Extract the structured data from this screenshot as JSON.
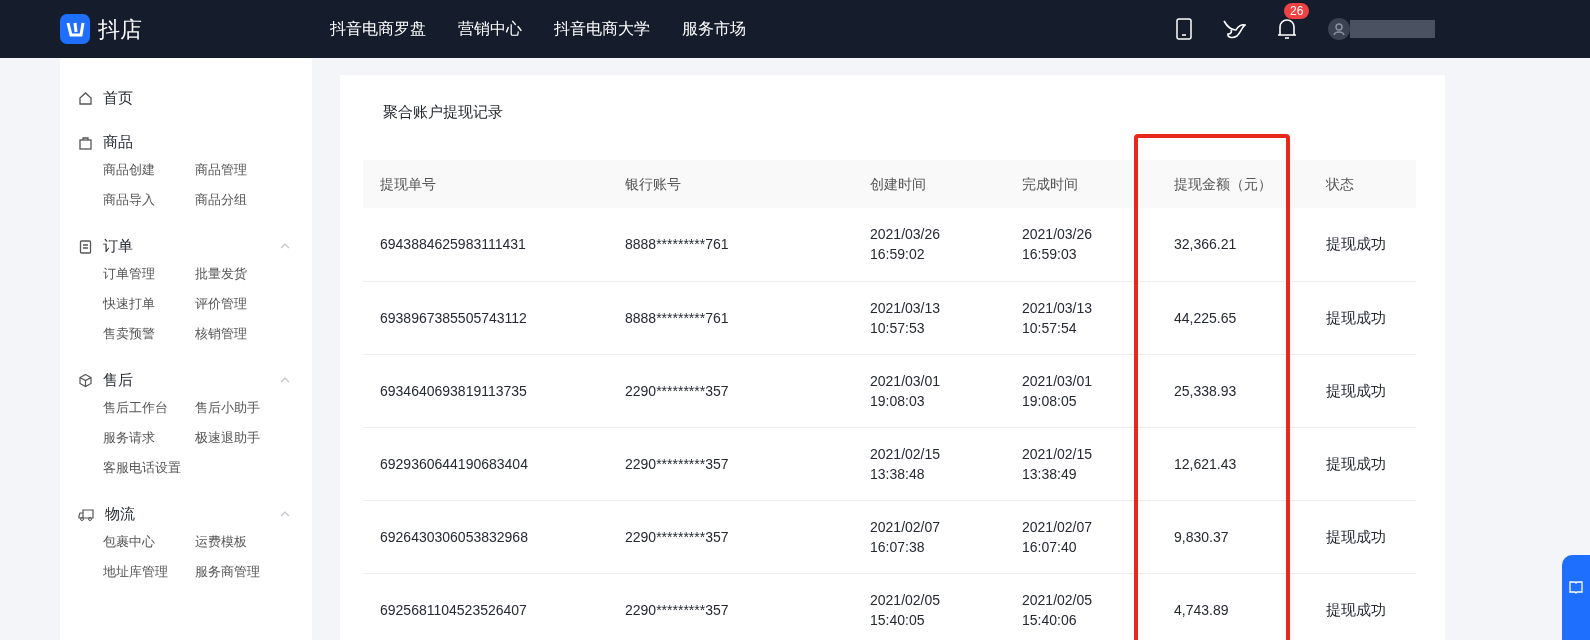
{
  "header": {
    "logo_text": "抖店",
    "nav": [
      "抖音电商罗盘",
      "营销中心",
      "抖音电商大学",
      "服务市场"
    ],
    "notification_count": "26"
  },
  "sidebar": {
    "items": [
      {
        "label": "首页",
        "expanded": false
      },
      {
        "label": "商品",
        "expanded": false,
        "children": [
          "商品创建",
          "商品管理",
          "商品导入",
          "商品分组"
        ]
      },
      {
        "label": "订单",
        "expanded": true,
        "children": [
          "订单管理",
          "批量发货",
          "快速打单",
          "评价管理",
          "售卖预警",
          "核销管理"
        ]
      },
      {
        "label": "售后",
        "expanded": true,
        "children": [
          "售后工作台",
          "售后小助手",
          "服务请求",
          "极速退助手",
          "客服电话设置"
        ]
      },
      {
        "label": "物流",
        "expanded": true,
        "children": [
          "包裹中心",
          "运费模板",
          "地址库管理",
          "服务商管理"
        ]
      }
    ]
  },
  "page_title": "聚合账户提现记录",
  "table": {
    "columns": [
      "提现单号",
      "银行账号",
      "创建时间",
      "完成时间",
      "提现金额（元）",
      "状态"
    ],
    "rows": [
      [
        "6943884625983111431",
        "8888*********761",
        "2021/03/26 16:59:02",
        "2021/03/26 16:59:03",
        "32,366.21",
        "提现成功"
      ],
      [
        "6938967385505743112",
        "8888*********761",
        "2021/03/13 10:57:53",
        "2021/03/13 10:57:54",
        "44,225.65",
        "提现成功"
      ],
      [
        "6934640693819113735",
        "2290*********357",
        "2021/03/01 19:08:03",
        "2021/03/01 19:08:05",
        "25,338.93",
        "提现成功"
      ],
      [
        "6929360644190683404",
        "2290*********357",
        "2021/02/15 13:38:48",
        "2021/02/15 13:38:49",
        "12,621.43",
        "提现成功"
      ],
      [
        "6926430306053832968",
        "2290*********357",
        "2021/02/07 16:07:38",
        "2021/02/07 16:07:40",
        "9,830.37",
        "提现成功"
      ],
      [
        "6925681104523526407",
        "2290*********357",
        "2021/02/05 15:40:05",
        "2021/02/05 15:40:06",
        "4,743.89",
        "提现成功"
      ]
    ]
  }
}
